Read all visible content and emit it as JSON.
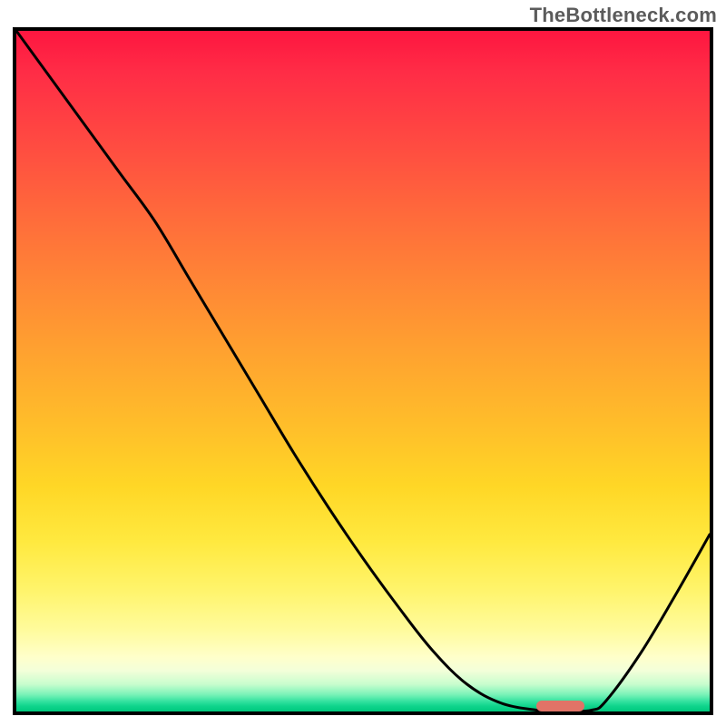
{
  "watermark": "TheBottleneck.com",
  "chart_data": {
    "type": "line",
    "title": "",
    "xlabel": "",
    "ylabel": "",
    "xlim": [
      0,
      100
    ],
    "ylim": [
      0,
      100
    ],
    "grid": false,
    "legend": false,
    "x": [
      0,
      5,
      10,
      15,
      20,
      25,
      30,
      35,
      40,
      45,
      50,
      55,
      60,
      65,
      70,
      75,
      77,
      80,
      83,
      85,
      90,
      95,
      100
    ],
    "values": [
      100,
      93,
      86,
      79,
      72,
      63.5,
      55,
      46.5,
      38,
      30,
      22.5,
      15.5,
      9,
      4,
      1.2,
      0.2,
      0,
      0,
      0.2,
      1.5,
      8.5,
      17,
      26
    ],
    "marker": {
      "x_start": 75,
      "x_end": 82,
      "y": 0.8,
      "color": "#e17367"
    },
    "background": {
      "type": "vertical-gradient",
      "stops": [
        {
          "pos": 0,
          "color": "#fe1640"
        },
        {
          "pos": 25,
          "color": "#ff7a39"
        },
        {
          "pos": 55,
          "color": "#ffc928"
        },
        {
          "pos": 80,
          "color": "#fff46a"
        },
        {
          "pos": 95,
          "color": "#d8ffd0"
        },
        {
          "pos": 100,
          "color": "#00c97e"
        }
      ]
    }
  },
  "plot": {
    "inner_width": 764,
    "inner_height": 750
  }
}
